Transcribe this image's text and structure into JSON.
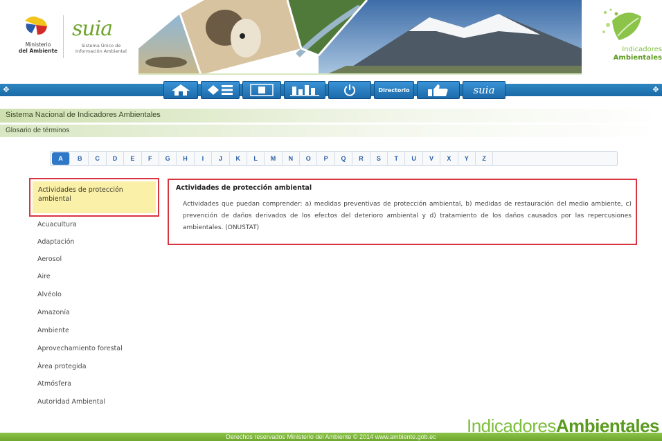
{
  "header": {
    "ministerio": {
      "line1": "Ministerio",
      "line2": "del Ambiente"
    },
    "suia": {
      "word": "suia",
      "sub1": "Sistema Único de",
      "sub2": "Información Ambiental"
    },
    "indicadores": {
      "line1": "Indicadores",
      "line2": "Ambientales"
    }
  },
  "nav": {
    "directorio_label": "Directorio",
    "suia_label": "suia"
  },
  "breadcrumb": {
    "system_title": "Sistema Nacional de Indicadores Ambientales",
    "section_title": "Glosario de términos"
  },
  "alphabet": [
    "A",
    "B",
    "C",
    "D",
    "E",
    "F",
    "G",
    "H",
    "I",
    "J",
    "K",
    "L",
    "M",
    "N",
    "O",
    "P",
    "Q",
    "R",
    "S",
    "T",
    "U",
    "V",
    "X",
    "Y",
    "Z"
  ],
  "active_letter": "A",
  "terms": [
    "Actividades de protección ambiental",
    "Acuacultura",
    "Adaptación",
    "Aerosol",
    "Aire",
    "Alvéolo",
    "Amazonía",
    "Ambiente",
    "Aprovechamiento forestal",
    "Área protegida",
    "Atmósfera",
    "Autoridad Ambiental"
  ],
  "definition": {
    "title": "Actividades de protección ambiental",
    "body": "Actividades que puedan comprender: a) medidas preventivas de protección ambiental, b) medidas de restauración del medio ambiente, c) prevención de daños derivados de los efectos del deterioro ambiental y d) tratamiento de los daños causados por las repercusiones ambientales. (ONUSTAT)"
  },
  "footer": {
    "brand_light": "Indicadores",
    "brand_bold": "Ambientales",
    "copyright": "Derechos reservados Ministerio del Ambiente © 2014 www.ambiente.gob.ec"
  },
  "colors": {
    "nav_blue": "#1c6aaa",
    "highlight_red": "#d9343f",
    "green": "#6ea62e",
    "selected_yellow": "#fbf0a8"
  }
}
